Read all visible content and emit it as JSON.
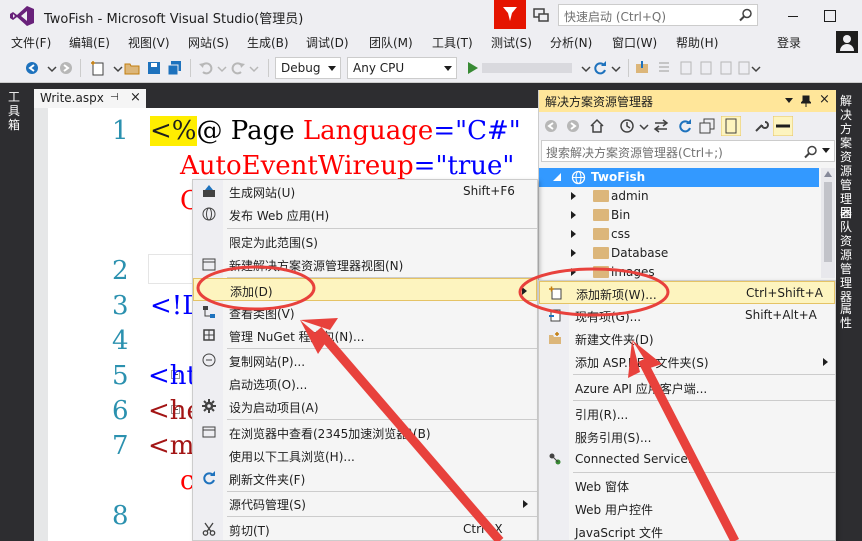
{
  "window": {
    "title": "TwoFish - Microsoft Visual Studio(管理员)",
    "quick_launch_placeholder": "快速启动 (Ctrl+Q)"
  },
  "menu": [
    "文件(F)",
    "编辑(E)",
    "视图(V)",
    "网站(S)",
    "生成(B)",
    "调试(D)",
    "团队(M)",
    "工具(T)",
    "测试(S)",
    "分析(N)",
    "窗口(W)",
    "帮助(H)"
  ],
  "login": "登录",
  "toolbar": {
    "config": "Debug",
    "platform": "Any CPU"
  },
  "toolbox_tab": "工具箱",
  "editor": {
    "tab_label": "Write.aspx",
    "pin": "⊣",
    "close": "×",
    "line_numbers": [
      "1",
      "2",
      "3",
      "4",
      "5",
      "6",
      "7",
      "8"
    ],
    "code_line1_a": "<%",
    "code_line1_b": "@ Page ",
    "code_line1_c": "Language",
    "code_line1_d": "=",
    "code_line1_e": "\"C#\"",
    "code_line1b_a": "AutoEventWireup",
    "code_line1b_b": "=",
    "code_line1b_c": "\"true\"",
    "code_frag_c": "C",
    "code_line3": "<!D",
    "code_line5": "<ht",
    "code_line6": "<he",
    "code_line7": "<me",
    "code_frag_c2": "c"
  },
  "solution_explorer": {
    "title": "解决方案资源管理器",
    "search_placeholder": "搜索解决方案资源管理器(Ctrl+;)",
    "root": "TwoFish",
    "items": [
      "admin",
      "Bin",
      "css",
      "Database",
      "images"
    ]
  },
  "right_tabs": [
    "解决方案资源管理器",
    "团队资源管理器",
    "属性"
  ],
  "context_menu_main": [
    {
      "label": "生成网站(U)",
      "shortcut": "Shift+F6"
    },
    {
      "label": "发布 Web 应用(H)",
      "shortcut": ""
    },
    {
      "label": "限定为此范围(S)",
      "shortcut": ""
    },
    {
      "label": "新建解决方案资源管理器视图(N)",
      "shortcut": ""
    },
    {
      "label": "添加(D)",
      "shortcut": ""
    },
    {
      "label": "查看类图(V)",
      "shortcut": ""
    },
    {
      "label": "管理 NuGet 程序包(N)...",
      "shortcut": ""
    },
    {
      "label": "复制网站(P)...",
      "shortcut": ""
    },
    {
      "label": "启动选项(O)...",
      "shortcut": ""
    },
    {
      "label": "设为启动项目(A)",
      "shortcut": ""
    },
    {
      "label": "在浏览器中查看(2345加速浏览器)(B)",
      "shortcut": ""
    },
    {
      "label": "使用以下工具浏览(H)...",
      "shortcut": ""
    },
    {
      "label": "刷新文件夹(F)",
      "shortcut": ""
    },
    {
      "label": "源代码管理(S)",
      "shortcut": ""
    },
    {
      "label": "剪切(T)",
      "shortcut": "Ctrl+X"
    }
  ],
  "context_menu_add": [
    {
      "label": "添加新项(W)...",
      "shortcut": "Ctrl+Shift+A"
    },
    {
      "label": "现有项(G)...",
      "shortcut": "Shift+Alt+A"
    },
    {
      "label": "新建文件夹(D)",
      "shortcut": ""
    },
    {
      "label": "添加 ASP.NET 文件夹(S)",
      "shortcut": ""
    },
    {
      "label": "Azure API 应用客户端...",
      "shortcut": ""
    },
    {
      "label": "引用(R)...",
      "shortcut": ""
    },
    {
      "label": "服务引用(S)...",
      "shortcut": ""
    },
    {
      "label": "Connected Service...",
      "shortcut": ""
    },
    {
      "label": "Web 窗体",
      "shortcut": ""
    },
    {
      "label": "Web 用户控件",
      "shortcut": ""
    },
    {
      "label": "JavaScript 文件",
      "shortcut": ""
    }
  ],
  "colors": {
    "annotation_red": "#e8413c",
    "highlight_bg": "#fdf4bf",
    "code_keyword_red": "#a31515",
    "code_blue": "#0000ff",
    "selection_blue": "#3399ff",
    "flag_red": "#e51400"
  }
}
